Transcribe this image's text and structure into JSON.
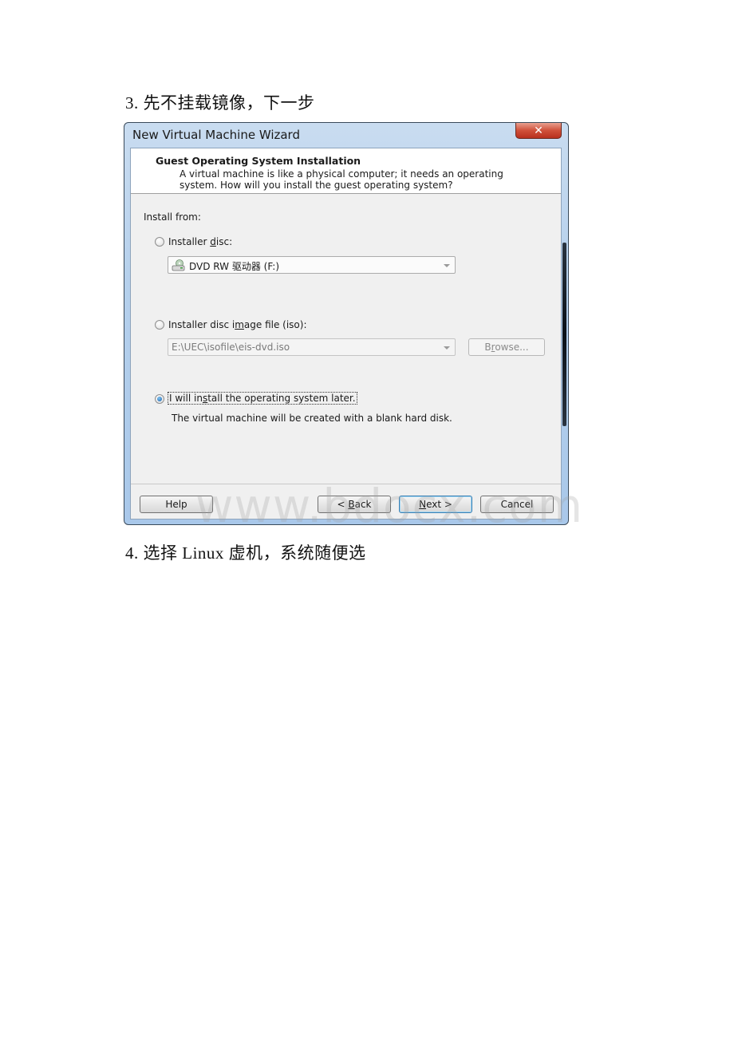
{
  "document": {
    "step3_heading": "3. 先不挂载镜像，下一步",
    "step4_heading": "4. 选择 Linux 虚机，系统随便选",
    "watermark": "www.bdocx.com"
  },
  "window": {
    "title": "New Virtual Machine Wizard",
    "close_label": "✕",
    "header": {
      "title": "Guest Operating System Installation",
      "description": "A virtual machine is like a physical computer; it needs an operating system. How will you install the guest operating system?"
    },
    "install_from_label": "Install from:",
    "options": {
      "installer_disc": {
        "label_pre": "Installer ",
        "label_mnemonic": "d",
        "label_post": "isc:",
        "selected": false,
        "combo_value": "DVD RW 驱动器 (F:)",
        "icon": "optical-drive-icon"
      },
      "iso_image": {
        "label_pre": "Installer disc i",
        "label_mnemonic": "m",
        "label_post": "age file (iso):",
        "selected": false,
        "combo_value": "E:\\UEC\\isofile\\eis-dvd.iso",
        "browse_pre": "B",
        "browse_mnemonic": "r",
        "browse_post": "owse..."
      },
      "install_later": {
        "label_pre": "I will in",
        "label_mnemonic": "s",
        "label_post": "tall the operating system later.",
        "selected": true,
        "description": "The virtual machine will be created with a blank hard disk."
      }
    },
    "buttons": {
      "help": "Help",
      "back_pre": "< ",
      "back_mnemonic": "B",
      "back_post": "ack",
      "next_mnemonic": "N",
      "next_post": "ext >",
      "cancel": "Cancel"
    }
  }
}
